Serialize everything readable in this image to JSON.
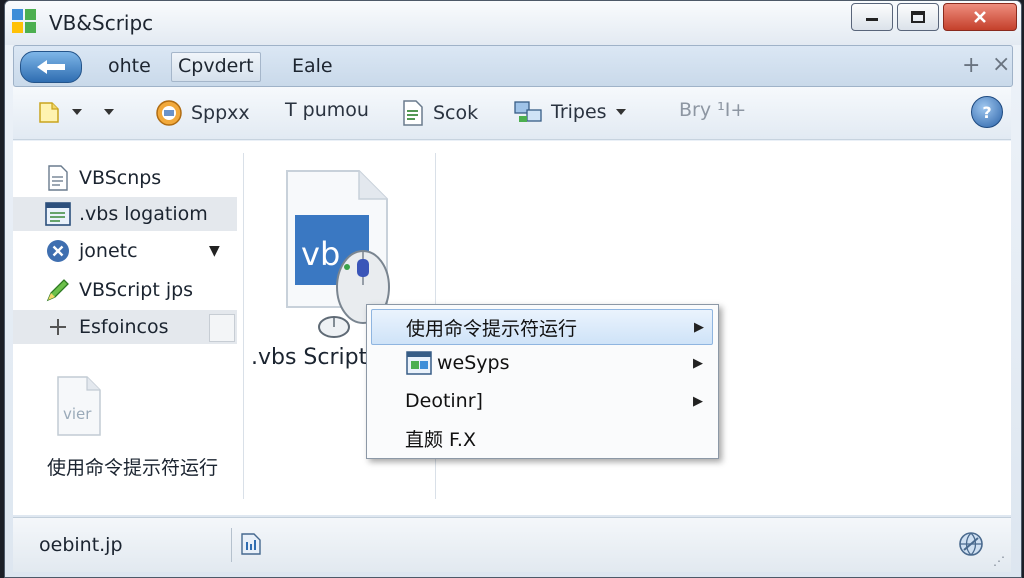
{
  "window": {
    "title": "VB&Scripc"
  },
  "nav": {
    "tabs": [
      {
        "label": "ohte"
      },
      {
        "label": "Cpvdert"
      },
      {
        "label": "Eale"
      }
    ]
  },
  "toolbar": {
    "spprx": "Sppxx",
    "pumou": "T pumou",
    "scok": "Scok",
    "tripes": "Tripes",
    "bry": "Bry ¹I+"
  },
  "sidebar": {
    "items": [
      {
        "label": "VBScnps"
      },
      {
        "label": ".vbs logatiom"
      },
      {
        "label": "jonetc"
      },
      {
        "label": "VBScript jps"
      },
      {
        "label": "Esfoincos"
      }
    ],
    "file_icon_text": "vier",
    "caption": "使用命令提示符运行"
  },
  "main": {
    "file_icon_text": "vb",
    "file_caption": ".vbs Script"
  },
  "context_menu": {
    "items": [
      {
        "label": "使用命令提示符运行"
      },
      {
        "label": "weSyps"
      },
      {
        "label": "Deotinr]"
      },
      {
        "label": "直颇 F.X"
      }
    ]
  },
  "status": {
    "text": "oebint.jp"
  },
  "colors": {
    "accent": "#2f6db1",
    "menu_hover": "#cfe3f8",
    "close": "#c4402b"
  }
}
